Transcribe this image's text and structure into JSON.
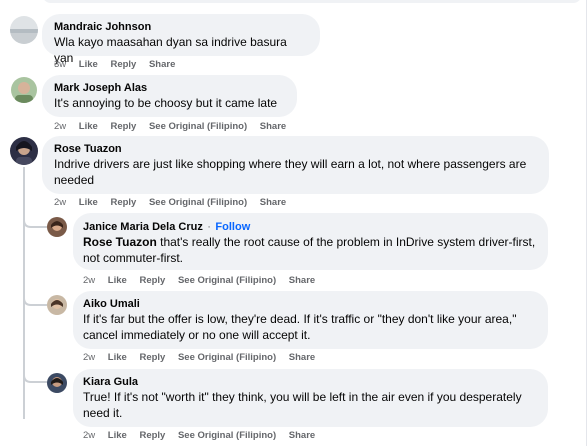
{
  "comments": [
    {
      "author": "Mandraic Johnson",
      "text": "Wla kayo maasahan dyan sa indrive basura yan",
      "time": "3w",
      "like": "Like",
      "reply": "Reply",
      "share": "Share"
    },
    {
      "author": "Mark Joseph Alas",
      "text": "It's annoying to be choosy but it came late",
      "time": "2w",
      "like": "Like",
      "reply": "Reply",
      "see_original": "See Original (Filipino)",
      "share": "Share"
    },
    {
      "author": "Rose Tuazon",
      "text": "Indrive drivers are just like shopping where they will earn a lot, not where passengers are needed",
      "time": "2w",
      "like": "Like",
      "reply": "Reply",
      "see_original": "See Original (Filipino)",
      "share": "Share"
    }
  ],
  "replies": [
    {
      "author": "Janice Maria Dela Cruz",
      "separator": "·",
      "follow": "Follow",
      "mention": "Rose Tuazon",
      "text": " that's really the root cause of the problem in InDrive system driver-first, not commuter-first.",
      "time": "2w",
      "like": "Like",
      "reply": "Reply",
      "see_original": "See Original (Filipino)",
      "share": "Share"
    },
    {
      "author": "Aiko Umali",
      "text": "If it's far but the offer is low, they're dead. If it's traffic or \"they don't like your area,\" cancel immediately or no one will accept it.",
      "time": "2w",
      "like": "Like",
      "reply": "Reply",
      "see_original": "See Original (Filipino)",
      "share": "Share"
    },
    {
      "author": "Kiara Gula",
      "text": "True! If it's not \"worth it\" they think, you will be left in the air even if you desperately need it.",
      "time": "2w",
      "like": "Like",
      "reply": "Reply",
      "see_original": "See Original (Filipino)",
      "share": "Share"
    }
  ]
}
